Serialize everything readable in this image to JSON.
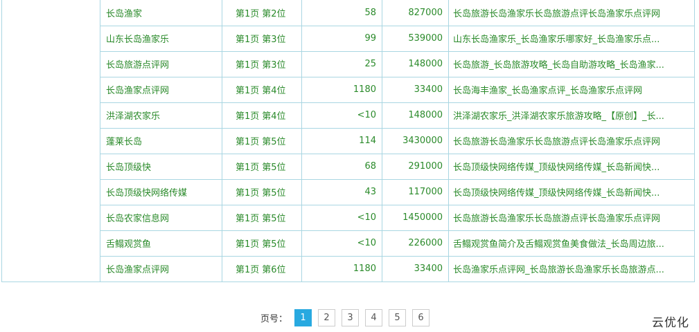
{
  "table": {
    "rows": [
      {
        "keyword": "长岛渔家",
        "rank_page": "第1页",
        "rank_pos": "第2位",
        "index": "58",
        "results": "827000",
        "title": "长岛旅游长岛渔家乐长岛旅游点评长岛渔家乐点评网"
      },
      {
        "keyword": "山东长岛渔家乐",
        "rank_page": "第1页",
        "rank_pos": "第3位",
        "index": "99",
        "results": "539000",
        "title": "山东长岛渔家乐_长岛渔家乐哪家好_长岛渔家乐点..."
      },
      {
        "keyword": "长岛旅游点评网",
        "rank_page": "第1页",
        "rank_pos": "第3位",
        "index": "25",
        "results": "148000",
        "title": "长岛旅游_长岛旅游攻略_长岛自助游攻略_长岛渔家..."
      },
      {
        "keyword": "长岛渔家点评网",
        "rank_page": "第1页",
        "rank_pos": "第4位",
        "index": "1180",
        "results": "33400",
        "title": "长岛海丰渔家_长岛渔家点评_长岛渔家乐点评网"
      },
      {
        "keyword": "洪泽湖农家乐",
        "rank_page": "第1页",
        "rank_pos": "第4位",
        "index": "<10",
        "results": "148000",
        "title": "洪泽湖农家乐_洪泽湖农家乐旅游攻略_【原创】_长..."
      },
      {
        "keyword": "蓬莱长岛",
        "rank_page": "第1页",
        "rank_pos": "第5位",
        "index": "114",
        "results": "3430000",
        "title": "长岛旅游长岛渔家乐长岛旅游点评长岛渔家乐点评网"
      },
      {
        "keyword": "长岛顶级快",
        "rank_page": "第1页",
        "rank_pos": "第5位",
        "index": "68",
        "results": "291000",
        "title": "长岛顶级快网络传媒_顶级快网络传媒_长岛新闻快..."
      },
      {
        "keyword": "长岛顶级快网络传媒",
        "rank_page": "第1页",
        "rank_pos": "第5位",
        "index": "43",
        "results": "117000",
        "title": "长岛顶级快网络传媒_顶级快网络传媒_长岛新闻快..."
      },
      {
        "keyword": "长岛农家信息网",
        "rank_page": "第1页",
        "rank_pos": "第5位",
        "index": "<10",
        "results": "1450000",
        "title": "长岛旅游长岛渔家乐长岛旅游点评长岛渔家乐点评网"
      },
      {
        "keyword": "舌鳎观赏鱼",
        "rank_page": "第1页",
        "rank_pos": "第5位",
        "index": "<10",
        "results": "226000",
        "title": "舌鳎观赏鱼简介及舌鳎观赏鱼美食做法_长岛周边旅..."
      },
      {
        "keyword": "长岛渔家点评网",
        "rank_page": "第1页",
        "rank_pos": "第6位",
        "index": "1180",
        "results": "33400",
        "title": "长岛渔家乐点评网_长岛旅游长岛渔家乐长岛旅游点..."
      }
    ]
  },
  "pager": {
    "label": "页号：",
    "pages": [
      "1",
      "2",
      "3",
      "4",
      "5",
      "6"
    ],
    "active": "1"
  },
  "watermark": "云优化",
  "colors": {
    "link_text": "#2a8a2a",
    "border": "#a9d6e2",
    "active_page": "#28a9e0"
  }
}
